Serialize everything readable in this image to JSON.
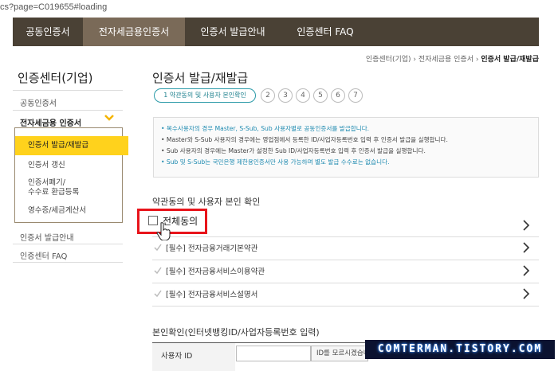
{
  "browser": {
    "url_fragment": "cs?page=C019655#loading"
  },
  "nav": {
    "tabs": [
      {
        "label": "공동인증서"
      },
      {
        "label": "전자세금용인증서"
      },
      {
        "label": "인증서 발급안내"
      },
      {
        "label": "인증센터 FAQ"
      }
    ]
  },
  "sidebar": {
    "title": "인증센터(기업)",
    "items": [
      {
        "label": "공동인증서"
      },
      {
        "label": "전자세금용 인증서"
      }
    ],
    "submenu": [
      {
        "label": "인증서 발급/재발급"
      },
      {
        "label": "인증서 갱신"
      },
      {
        "label": "인증서폐기/\n수수료 환급등록"
      },
      {
        "label": "영수증/세금계산서"
      }
    ],
    "bottom_items": [
      {
        "label": "인증서 발급안내"
      },
      {
        "label": "인증센터 FAQ"
      }
    ]
  },
  "breadcrumb": {
    "items": [
      "인증센터(기업)",
      "전자세금용 인증서",
      "인증서 발급/재발급"
    ]
  },
  "main": {
    "title": "인증서 발급/재발급",
    "steps": {
      "current_label": "1 약관동의 및 사용자 본인확인",
      "others": [
        "2",
        "3",
        "4",
        "5",
        "6",
        "7"
      ]
    },
    "notices": [
      "• 복수사용자의 경우 Master, S-Sub, Sub 사용자별로 공동인증서를 발급합니다.",
      "• Master와 S-Sub 사용자의 경우에는 영업점에서 등록한 ID/사업자등록번호 입력 후 인증서 발급을 실행합니다.",
      "• Sub 사용자의 경우에는 Master가 설정한 Sub ID/사업자등록번호 입력 후 인증서 발급을 실행합니다.",
      "• Sub 및 S-Sub는 국민은행 제한용인증서만 사용 가능하며 별도 발급 수수료는 없습니다."
    ],
    "agree_section_title": "약관동의 및 사용자 본인 확인",
    "agree_all_label": "전체동의",
    "terms": [
      {
        "label": "[필수] 전자금융거래기본약관"
      },
      {
        "label": "[필수] 전자금융서비스이용약관"
      },
      {
        "label": "[필수] 전자금융서비스설명서"
      }
    ],
    "identity_section_title": "본인확인(인터넷뱅킹ID/사업자등록번호 입력)",
    "user_id_label": "사용자 ID",
    "user_id_value": "",
    "id_button_label": "ID를 모르시겠습니까?"
  },
  "watermark": {
    "text": "COMTERMAN.TISTORY.COM"
  },
  "colors": {
    "nav_bg": "#4a4135",
    "nav_active": "#7a6a58",
    "submenu_active": "#ffd21c",
    "step_accent": "#2a9aa8",
    "highlight": "#e8141b"
  }
}
